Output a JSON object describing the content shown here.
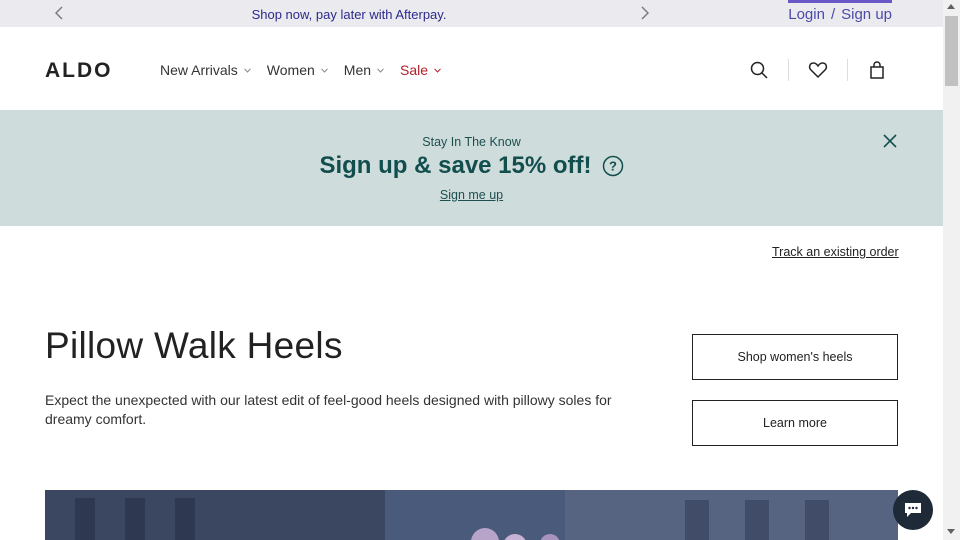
{
  "promo": {
    "text": "Shop now, pay later with Afterpay.",
    "prev_icon": "chevron-left-icon",
    "next_icon": "chevron-right-icon"
  },
  "auth": {
    "login": "Login",
    "separator": "/",
    "signup": "Sign up",
    "accent": "#6a58c9"
  },
  "header": {
    "logo": "ALDO",
    "nav": [
      {
        "label": "New Arrivals"
      },
      {
        "label": "Women"
      },
      {
        "label": "Men"
      },
      {
        "label": "Sale",
        "color": "#b3202a"
      }
    ],
    "icons": [
      "search-icon",
      "heart-icon",
      "bag-icon"
    ]
  },
  "signup_banner": {
    "eyebrow": "Stay In The Know",
    "headline": "Sign up & save 15% off!",
    "link": "Sign me up",
    "background": "#cfdcdc",
    "text_color": "#124e4e"
  },
  "main": {
    "track_order": "Track an existing order",
    "title": "Pillow Walk Heels",
    "description": "Expect the unexpected with our latest edit of feel-good heels designed with pillowy soles for dreamy comfort.",
    "cta_primary": "Shop women's heels",
    "cta_secondary": "Learn more"
  },
  "chat": {
    "icon": "chat-icon"
  }
}
